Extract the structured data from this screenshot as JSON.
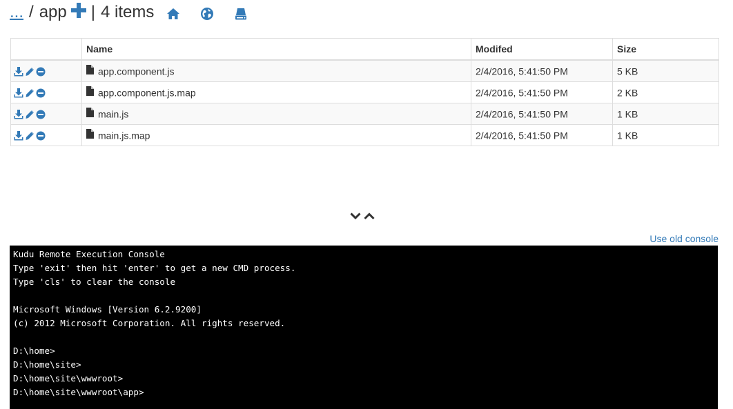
{
  "header": {
    "parent_link": "...",
    "separator": "/",
    "folder": "app",
    "pipe": "|",
    "item_count": "4 items",
    "icons": [
      "plus-icon",
      "home-icon",
      "globe-icon",
      "drive-icon"
    ],
    "accent_color": "#337ab7"
  },
  "table": {
    "columns": [
      "",
      "Name",
      "Modifed",
      "Size"
    ],
    "rows": [
      {
        "name": "app.component.js",
        "modified": "2/4/2016, 5:41:50 PM",
        "size": "5 KB"
      },
      {
        "name": "app.component.js.map",
        "modified": "2/4/2016, 5:41:50 PM",
        "size": "2 KB"
      },
      {
        "name": "main.js",
        "modified": "2/4/2016, 5:41:50 PM",
        "size": "1 KB"
      },
      {
        "name": "main.js.map",
        "modified": "2/4/2016, 5:41:50 PM",
        "size": "1 KB"
      }
    ],
    "row_action_icons": [
      "download-icon",
      "pencil-icon",
      "minus-circle-icon"
    ]
  },
  "splitter_icons": [
    "chevron-down-icon",
    "chevron-up-icon"
  ],
  "console": {
    "old_console_link": "Use old console",
    "lines": [
      "Kudu Remote Execution Console",
      "Type 'exit' then hit 'enter' to get a new CMD process.",
      "Type 'cls' to clear the console",
      "",
      "Microsoft Windows [Version 6.2.9200]",
      "(c) 2012 Microsoft Corporation. All rights reserved.",
      "",
      "D:\\home>",
      "D:\\home\\site>",
      "D:\\home\\site\\wwwroot>",
      "D:\\home\\site\\wwwroot\\app>"
    ]
  }
}
